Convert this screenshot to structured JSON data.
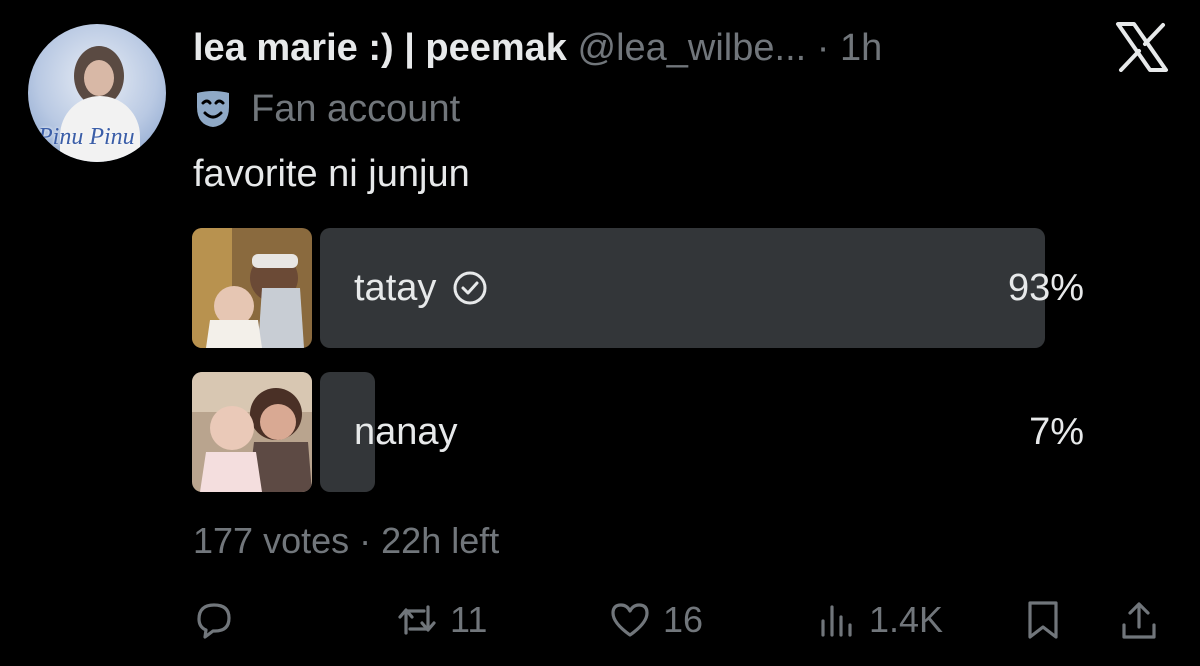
{
  "author": {
    "display_name": "lea marie :) | peemak",
    "handle": "@lea_wilbe...",
    "separator": "·",
    "time": "1h",
    "label": "Fan account",
    "avatar_text": "Pinu Pinu"
  },
  "tweet": {
    "text": "favorite ni junjun"
  },
  "poll": {
    "options": [
      {
        "label": "tatay",
        "percent_text": "93%",
        "percent": 93,
        "selected": true
      },
      {
        "label": "nanay",
        "percent_text": "7%",
        "percent": 7,
        "selected": false
      }
    ],
    "votes": "177 votes",
    "separator": "·",
    "time_left": "22h left"
  },
  "actions": {
    "reply_count": "",
    "repost_count": "11",
    "like_count": "16",
    "views_count": "1.4K"
  },
  "icons": {
    "brand": "x-logo-icon",
    "label": "theater-mask-icon",
    "selected": "check-circle-icon",
    "reply": "reply-icon",
    "repost": "repost-icon",
    "like": "heart-icon",
    "views": "views-icon",
    "bookmark": "bookmark-icon",
    "share": "share-icon"
  },
  "colors": {
    "background": "#000000",
    "text_primary": "#e7e9ea",
    "text_secondary": "#71767b",
    "poll_bar": "#333639",
    "label_icon": "#8fa9c6"
  }
}
